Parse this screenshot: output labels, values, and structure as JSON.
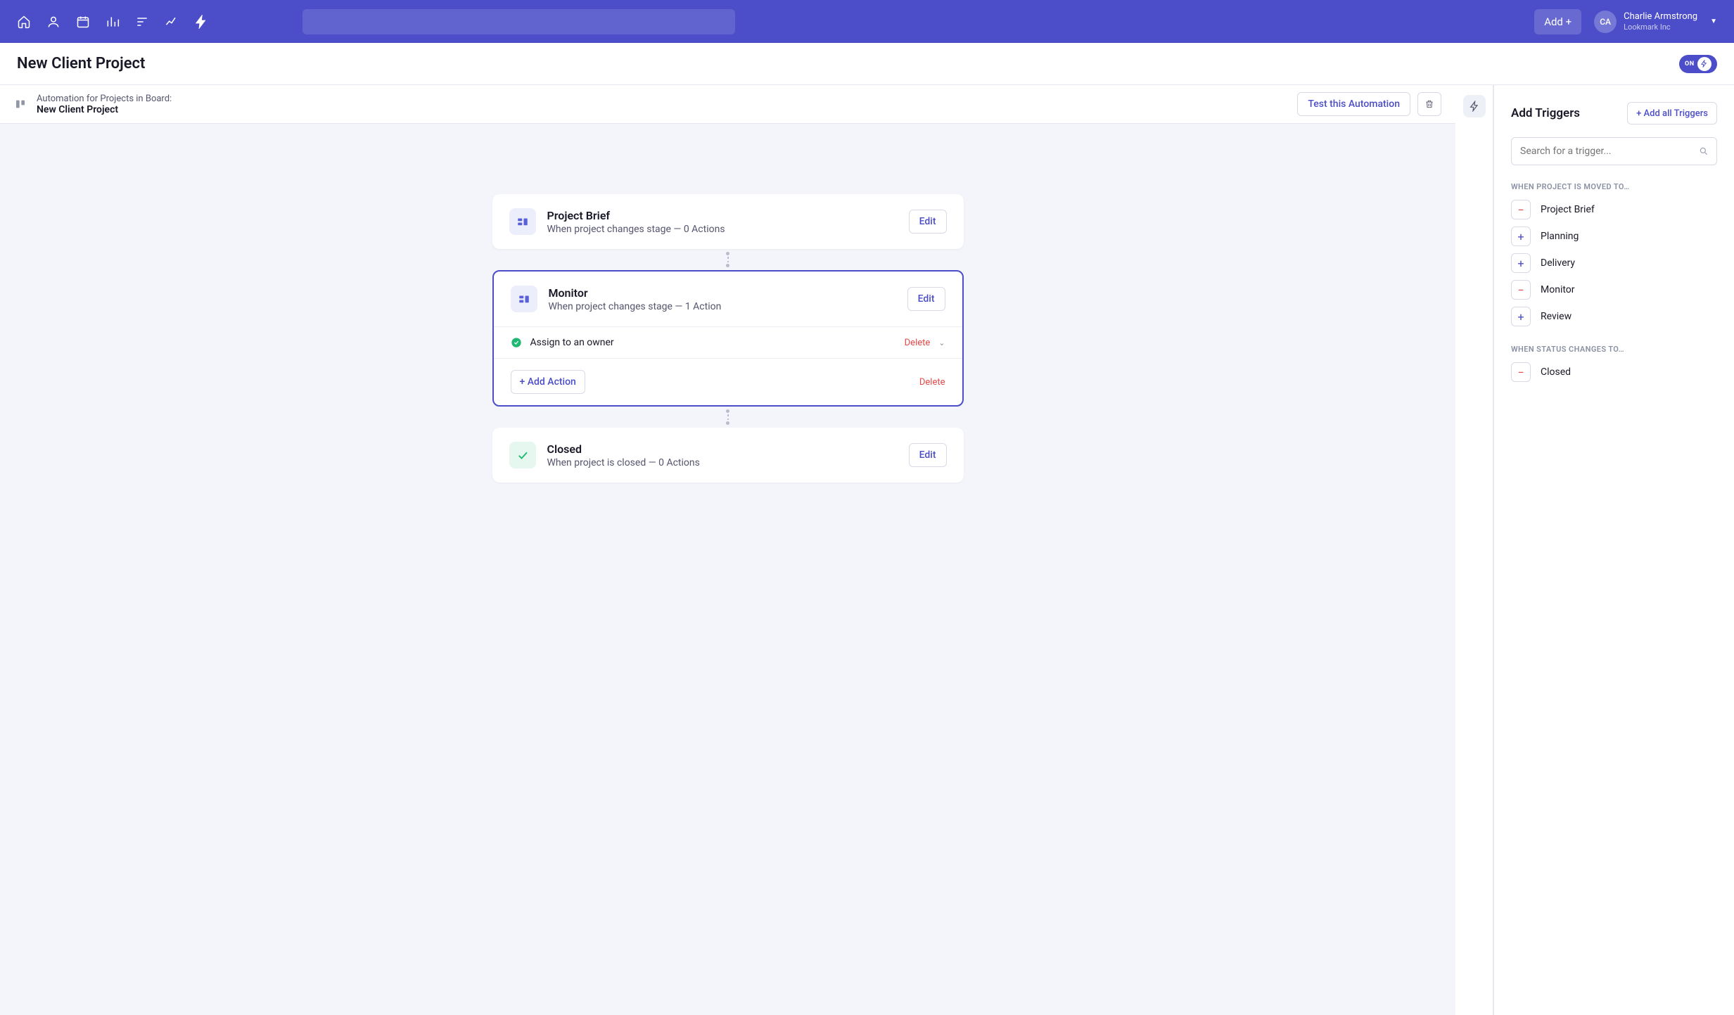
{
  "nav": {
    "add_label": "Add +",
    "user_initials": "CA",
    "user_name": "Charlie Armstrong",
    "user_org": "Lookmark Inc"
  },
  "page": {
    "title": "New Client Project",
    "toggle_state": "ON"
  },
  "canvas_header": {
    "line1": "Automation for Projects in Board:",
    "line2": "New Client Project",
    "test_label": "Test this Automation"
  },
  "flow": [
    {
      "id": "brief",
      "title": "Project Brief",
      "sub": "When project changes stage — 0 Actions",
      "edit": "Edit",
      "selected": false,
      "icon": "board"
    },
    {
      "id": "monitor",
      "title": "Monitor",
      "sub": "When project changes stage — 1 Action",
      "edit": "Edit",
      "selected": true,
      "icon": "board",
      "action_label": "Assign to an owner",
      "action_delete": "Delete",
      "add_action": "+ Add Action",
      "footer_delete": "Delete"
    },
    {
      "id": "closed",
      "title": "Closed",
      "sub": "When project is closed — 0 Actions",
      "edit": "Edit",
      "selected": false,
      "icon": "check"
    }
  ],
  "panel": {
    "title": "Add Triggers",
    "add_all": "+  Add all Triggers",
    "search_placeholder": "Search for a trigger...",
    "section1_label": "When project is moved to…",
    "section1": [
      {
        "name": "Project Brief",
        "state": "remove"
      },
      {
        "name": "Planning",
        "state": "add"
      },
      {
        "name": "Delivery",
        "state": "add"
      },
      {
        "name": "Monitor",
        "state": "remove"
      },
      {
        "name": "Review",
        "state": "add"
      }
    ],
    "section2_label": "When status changes to…",
    "section2": [
      {
        "name": "Closed",
        "state": "remove"
      }
    ]
  }
}
